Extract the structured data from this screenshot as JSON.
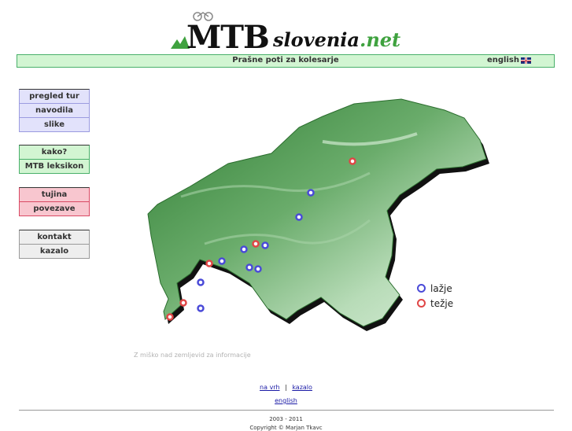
{
  "header": {
    "logo_main": "MTB",
    "logo_word": "slovenia",
    "logo_tld": ".net",
    "slogan": "Prašne poti za kolesarje",
    "language_link": "english",
    "flag_icon": "uk-flag-icon"
  },
  "menu": {
    "group1": [
      "pregled tur",
      "navodila",
      "slike"
    ],
    "group2": [
      "kako?",
      "MTB leksikon"
    ],
    "group3": [
      "tujina",
      "povezave"
    ],
    "group4": [
      "kontakt",
      "kazalo"
    ]
  },
  "colors": {
    "easy": "#4a4ad8",
    "hard": "#e04646",
    "green_bar": "#d2f5d2",
    "map_green": "#3f8f3f"
  },
  "legend": {
    "easy_label": "lažje",
    "hard_label": "težje"
  },
  "map_hint": "Z miško nad zemljevid za informacije",
  "footer_links": {
    "top": "na vrh",
    "separator": "|",
    "index": "kazalo",
    "english": "english"
  },
  "footer": {
    "years": "2003 - 2011",
    "copyright": "Copyright © Marjan Tkavc"
  }
}
